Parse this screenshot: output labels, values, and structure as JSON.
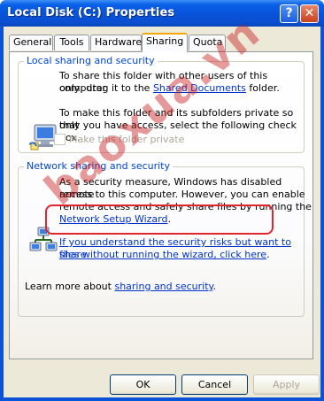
{
  "window": {
    "title": "Local Disk (C:) Properties"
  },
  "titlebar": {
    "help_label": "?",
    "close_label": "✕"
  },
  "tabs": [
    {
      "label": "General"
    },
    {
      "label": "Tools"
    },
    {
      "label": "Hardware"
    },
    {
      "label": "Sharing"
    },
    {
      "label": "Quota"
    }
  ],
  "local_group": {
    "title": "Local sharing and security",
    "line1_pre": "To share this folder with other users of this computer",
    "line2_pre": "only, drag it to the ",
    "line2_link": "Shared Documents",
    "line2_post": " folder.",
    "line3": "To make this folder and its subfolders private so that",
    "line4": "only you have access, select the following check box.",
    "checkbox_label": "Make this folder private"
  },
  "network_group": {
    "title": "Network sharing and security",
    "line1": "As a security measure, Windows has disabled remote",
    "line2": "access to this computer. However, you can enable",
    "line3": "remote access and safely share files by running the",
    "wizard_link": "Network Setup Wizard",
    "risk_link_line1": "If you understand the security risks but want to share",
    "risk_link_line2": "files without running the wizard, click here",
    "risk_link_period": ".",
    "learn_pre": "Learn more about ",
    "learn_link": "sharing and security",
    "learn_post": "."
  },
  "buttons": {
    "ok": "OK",
    "cancel": "Cancel",
    "apply": "Apply"
  },
  "watermark": "baoxua.vn",
  "colors": {
    "titlebar": "#0852d8",
    "group_title": "#0046d5",
    "link": "#0033cc",
    "highlight": "#e0262b"
  }
}
